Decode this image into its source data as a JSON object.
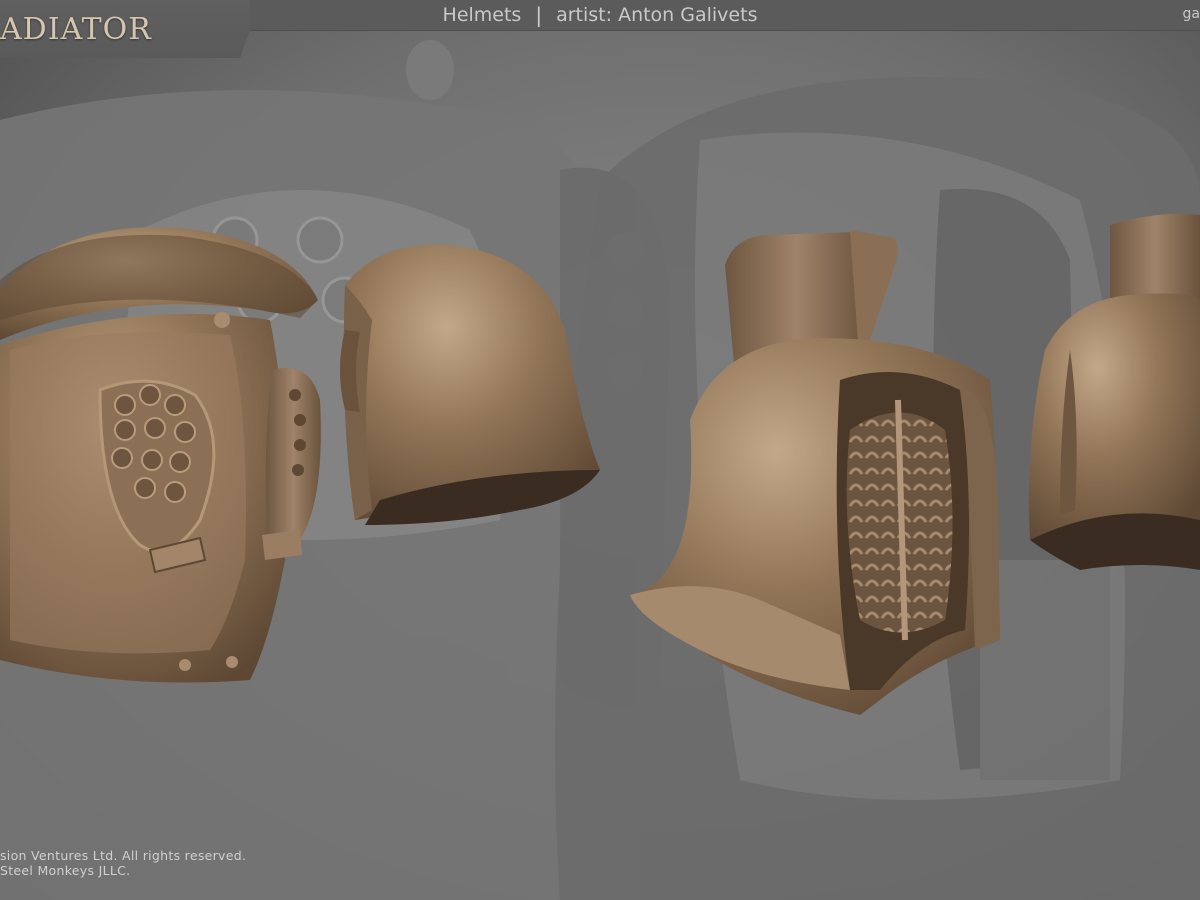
{
  "brand": {
    "logo_text": "ADIATOR"
  },
  "header": {
    "category": "Helmets",
    "separator": "|",
    "artist_label": "artist: Anton Galivets",
    "corner_text": "ga"
  },
  "footer": {
    "line1": "sion Ventures Ltd. All rights reserved.",
    "line2": "Steel Monkeys JLLC."
  },
  "colors": {
    "background": "#6f6f6f",
    "top_bar": "#5b5b5b",
    "helmet_bronze": "#8e7458",
    "logo_text": "#d6c6ae"
  }
}
